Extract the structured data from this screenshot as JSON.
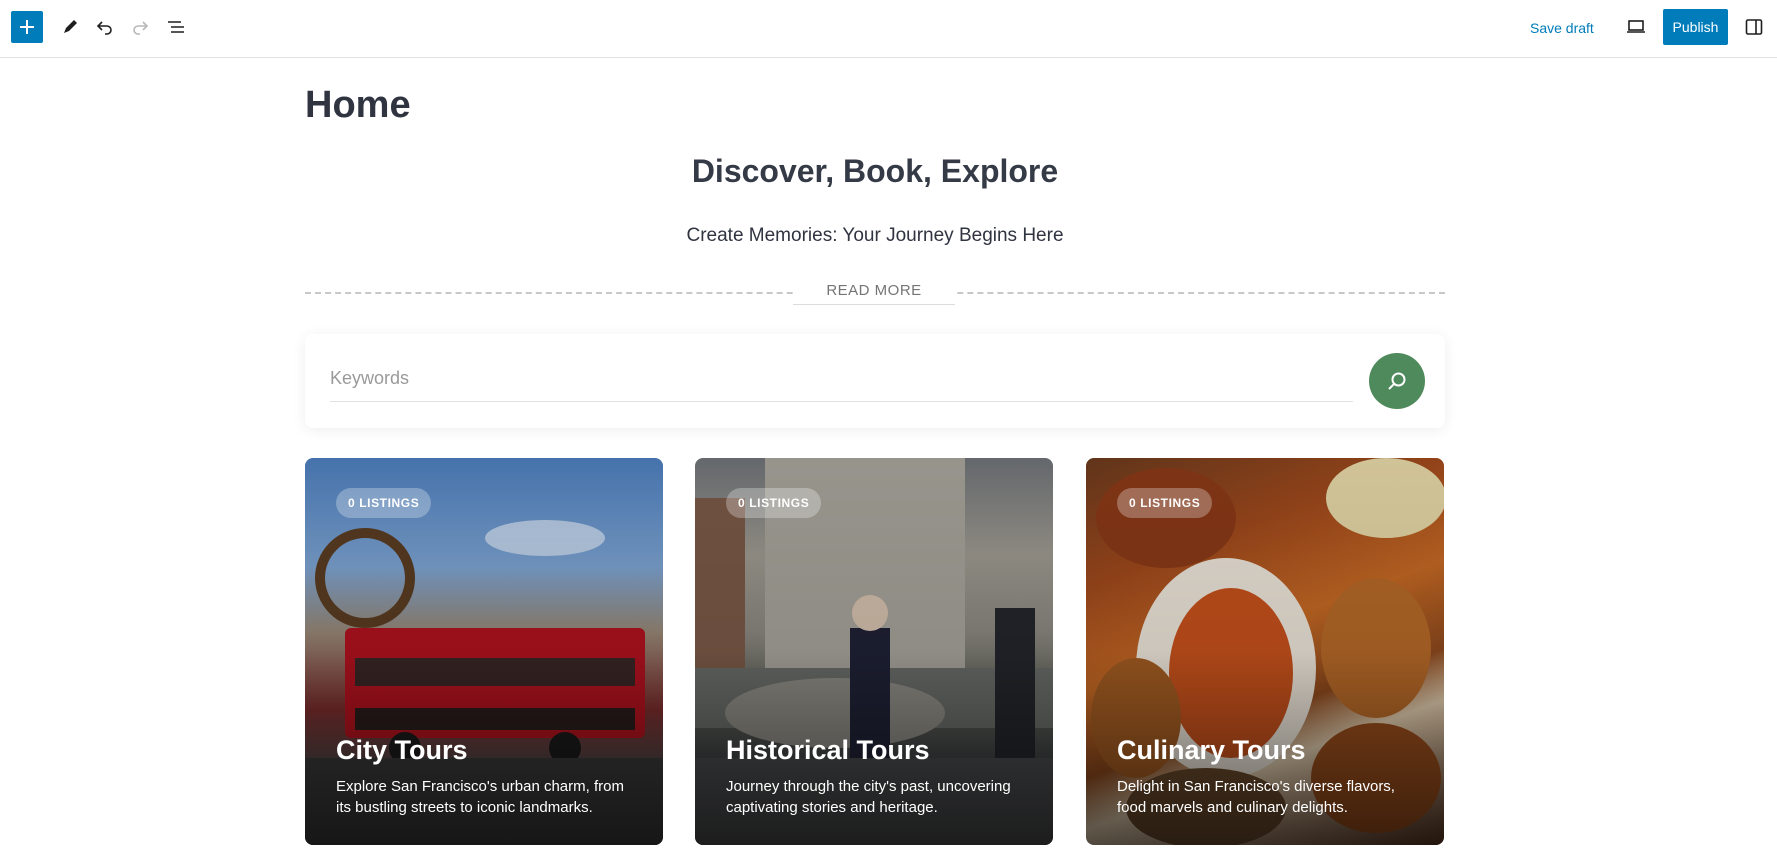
{
  "toolbar": {
    "add_icon": "plus-icon",
    "tools_icon": "pencil-icon",
    "undo_icon": "undo-icon",
    "redo_icon": "redo-icon",
    "list_view_icon": "list-view-icon",
    "save_draft_label": "Save draft",
    "preview_icon": "laptop-icon",
    "publish_label": "Publish",
    "settings_icon": "sidebar-icon",
    "accent_color": "#007cba"
  },
  "post": {
    "title": "Home"
  },
  "hero": {
    "heading": "Discover, Book, Explore",
    "subheading": "Create Memories: Your Journey Begins Here",
    "read_more": "READ MORE"
  },
  "search": {
    "placeholder": "Keywords",
    "value": "",
    "button_icon": "search-icon",
    "button_color": "#4f8a5c"
  },
  "categories": [
    {
      "badge": "0 LISTINGS",
      "title": "City Tours",
      "description": "Explore San Francisco's urban charm, from its bustling streets to iconic landmarks."
    },
    {
      "badge": "0 LISTINGS",
      "title": "Historical Tours",
      "description": "Journey through the city's past, uncovering captivating stories and heritage."
    },
    {
      "badge": "0 LISTINGS",
      "title": "Culinary Tours",
      "description": "Delight in San Francisco's diverse flavors, food marvels and culinary delights."
    }
  ]
}
